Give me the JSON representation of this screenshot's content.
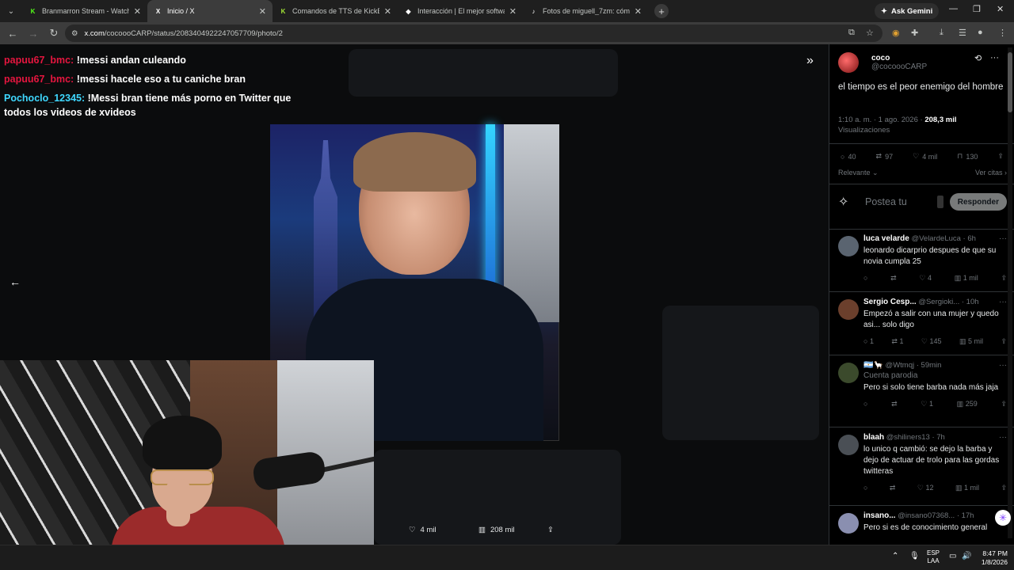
{
  "browser": {
    "tabs": [
      {
        "title": "Branmarron Stream - Watch Li",
        "favicon": "K",
        "favicon_color": "#53fc18",
        "active": false
      },
      {
        "title": "Inicio / X",
        "favicon": "X",
        "favicon_color": "#ffffff",
        "active": true
      },
      {
        "title": "Comandos de TTS de KickBot",
        "favicon": "K",
        "favicon_color": "#a3e635",
        "active": false
      },
      {
        "title": "Interacción | El mejor software d",
        "favicon": "◆",
        "favicon_color": "#ffffff",
        "active": false
      },
      {
        "title": "Fotos de miguell_7zm: cómo en",
        "favicon": "♪",
        "favicon_color": "#ffffff",
        "active": false
      }
    ],
    "ask_gemini": "Ask Gemini",
    "url_host": "x.com",
    "url_path": "/cocoooCARP/status/2083404922247057709/photo/2"
  },
  "chat": {
    "messages": [
      {
        "user": "papuu67_bmc:",
        "text": "!messi andan culeando",
        "user_color": "#e5163f"
      },
      {
        "user": "papuu67_bmc:",
        "text": "!messi hacele eso a tu caniche bran",
        "user_color": "#e5163f"
      },
      {
        "user": "Pochoclo_12345:",
        "text": "!Messi bran tiene más porno en Twitter que todos los videos de xvideos",
        "user_color": "#3fd8ff"
      }
    ]
  },
  "media_actions": {
    "likes": "4 mil",
    "views": "208 mil"
  },
  "tweet": {
    "author_name": "coco",
    "author_handle": "@cocoooCARP",
    "text": "el tiempo es el peor enemigo del hombre",
    "time": "1:10 a. m. · 1 ago. 2026 ·",
    "views_count": "208,3 mil",
    "views_label": "Visualizaciones",
    "stats": {
      "replies": "40",
      "reposts": "97",
      "likes": "4 mil",
      "bookmarks": "130"
    },
    "sort_label": "Relevante",
    "quotes_link": "Ver citas",
    "reply_placeholder": "Postea tu",
    "reply_button": "Responder"
  },
  "replies": [
    {
      "name": "luca velarde",
      "handle": "@VelardeLuca · 6h",
      "text": "leonardo dicarprio despues de que su novia cumpla 25",
      "replies": "",
      "reposts": "",
      "likes": "4",
      "views": "1 mil",
      "parody": ""
    },
    {
      "name": "Sergio Cesp...",
      "handle": "@Sergioki... · 10h",
      "text": "Empezó a salir con una mujer y quedo asi... solo digo",
      "replies": "1",
      "reposts": "1",
      "likes": "145",
      "views": "5 mil",
      "parody": ""
    },
    {
      "name": "🇦🇷🦙",
      "handle": "@Wtmqj · 59min",
      "text": "Pero si solo tiene barba nada más jaja",
      "replies": "",
      "reposts": "",
      "likes": "1",
      "views": "259",
      "parody": "Cuenta parodia"
    },
    {
      "name": "blaah",
      "handle": "@shiliners13 · 7h",
      "text": "lo unico q cambió: se dejo la barba y dejo de actuar de trolo para las gordas twitteras",
      "replies": "",
      "reposts": "",
      "likes": "12",
      "views": "1 mil",
      "parody": ""
    },
    {
      "name": "insano...",
      "handle": "@insano07368... · 17h",
      "text": "Pero si es de conocimiento general",
      "replies": "",
      "reposts": "",
      "likes": "",
      "views": "",
      "parody": ""
    }
  ],
  "taskbar": {
    "lang_top": "ESP",
    "lang_bottom": "LAA",
    "time": "8:47 PM",
    "date": "1/8/2026"
  }
}
